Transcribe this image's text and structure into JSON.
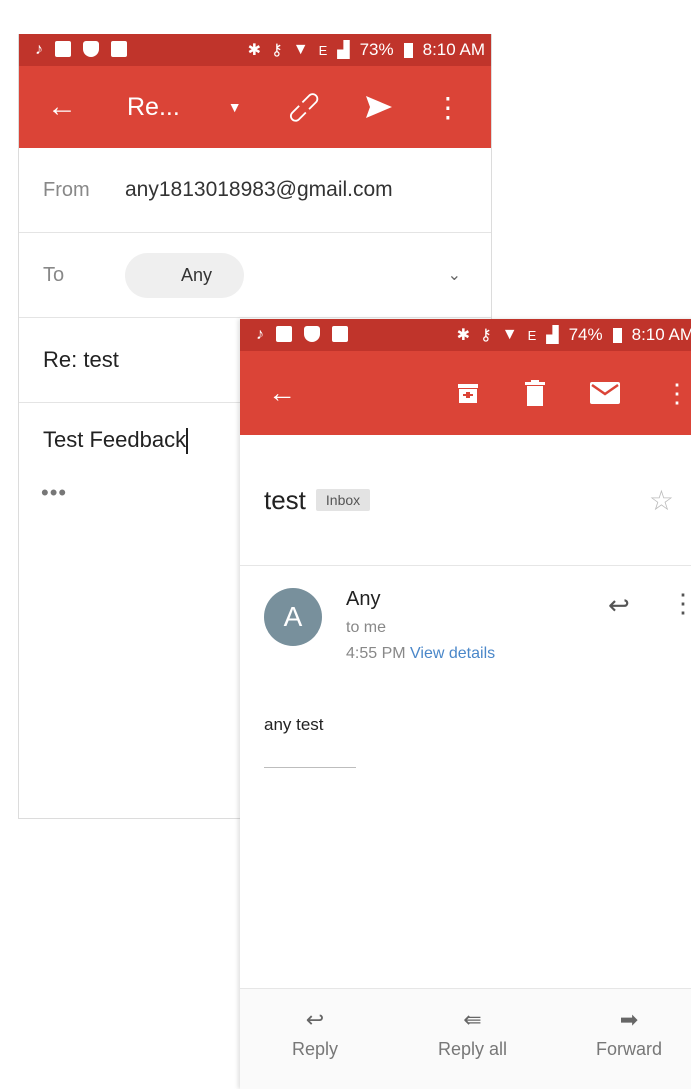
{
  "compose": {
    "status": {
      "battery": "73%",
      "time": "8:10 AM",
      "network": "E"
    },
    "title": "Re...",
    "from_label": "From",
    "from_value": "any1813018983@gmail.com",
    "to_label": "To",
    "to_chip": "Any",
    "subject": "Re: test",
    "body": "Test Feedback",
    "quoted": "•••"
  },
  "email": {
    "status": {
      "battery": "74%",
      "time": "8:10 AM",
      "network": "E"
    },
    "subject": "test",
    "label": "Inbox",
    "avatar_letter": "A",
    "sender": "Any",
    "to_me": "to me",
    "time": "4:55 PM",
    "details_link": "View details",
    "body": "any test",
    "bottom": {
      "reply": "Reply",
      "reply_all": "Reply all",
      "forward": "Forward"
    }
  },
  "colors": {
    "appbar": "#db4437",
    "statusbar": "#c0342b",
    "avatar": "#78909c",
    "link": "#4a87c9"
  }
}
